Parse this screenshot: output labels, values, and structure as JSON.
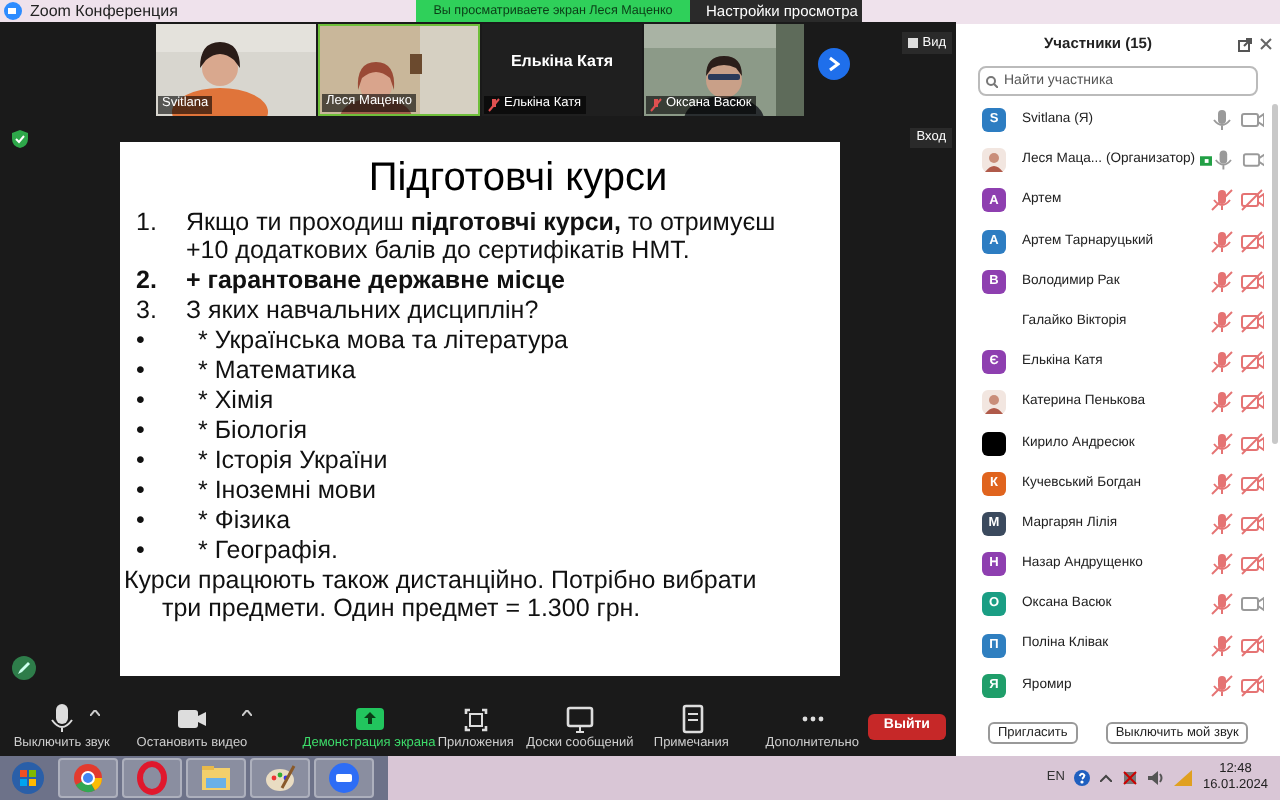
{
  "window": {
    "title": "Zoom Конференция"
  },
  "share_banner": {
    "text": "Вы просматриваете экран Леся Маценко",
    "view_settings": "Настройки просмотра"
  },
  "video_tiles": [
    {
      "name": "Svitlana",
      "kind": "picture",
      "muted": false
    },
    {
      "name": "Леся Маценко",
      "kind": "picture",
      "muted": false
    },
    {
      "name": "Елькіна Катя",
      "kind": "no_video",
      "muted": true,
      "center_name": "Елькіна Катя"
    },
    {
      "name": "Оксана Васюк",
      "kind": "picture",
      "muted": true
    }
  ],
  "view_button": "Вид",
  "enter_label": "Вход",
  "slide": {
    "title": "Підготовчі курси",
    "lines": [
      {
        "kind": "numbered",
        "marker": "1.",
        "text": "Якщо ти проходиш **підготовчі курси,** то отримуєш +10 додаткових балів до  сертифікатів НМТ.",
        "bold": false
      },
      {
        "kind": "numbered",
        "marker": "2.",
        "text": "+ гарантоване державне місце",
        "bold": true
      },
      {
        "kind": "numbered",
        "marker": "3.",
        "text": "З яких навчальних дисциплін?",
        "bold": false
      },
      {
        "kind": "bullet",
        "marker": "•",
        "text": "* Українська мова та література",
        "bold": false
      },
      {
        "kind": "bullet",
        "marker": "•",
        "text": "* Математика",
        "bold": false
      },
      {
        "kind": "bullet",
        "marker": "•",
        "text": "* Хімія",
        "bold": false
      },
      {
        "kind": "bullet",
        "marker": "•",
        "text": "* Біологія",
        "bold": false
      },
      {
        "kind": "bullet",
        "marker": "•",
        "text": "* Історія України",
        "bold": false
      },
      {
        "kind": "bullet",
        "marker": "•",
        "text": "* Іноземні мови",
        "bold": false
      },
      {
        "kind": "bullet",
        "marker": "•",
        "text": "* Фізика",
        "bold": false
      },
      {
        "kind": "bullet",
        "marker": "•",
        "text": "* Географія.",
        "bold": false
      },
      {
        "kind": "plain",
        "text": "Курси працюють також дистанційно. Потрібно вибрати три предмети. Один предмет = 1.300 грн.",
        "bold": false
      }
    ]
  },
  "toolbar": [
    {
      "kind": "mic",
      "label": "Выключить звук",
      "caret": true,
      "active": false
    },
    {
      "kind": "video",
      "label": "Остановить видео",
      "caret": true,
      "active": false
    },
    {
      "kind": "share",
      "label": "Демонстрация экрана",
      "caret": false,
      "active": true
    },
    {
      "kind": "apps",
      "label": "Приложения",
      "caret": false,
      "active": false
    },
    {
      "kind": "board",
      "label": "Доски сообщений",
      "caret": false,
      "active": false
    },
    {
      "kind": "notes",
      "label": "Примечания",
      "caret": false,
      "active": false
    },
    {
      "kind": "more",
      "label": "Дополнительно",
      "caret": false,
      "active": false
    }
  ],
  "leave_button": "Выйти",
  "participants": {
    "title": "Участники (15)",
    "search_placeholder": "Найти участника",
    "items": [
      {
        "name": "Svitlana (Я)",
        "kind": "letter",
        "letter": "S",
        "color": "#2d7dc2",
        "mic_muted": false,
        "video_off": false
      },
      {
        "name": "Леся Маца... (Организатор)",
        "mic_muted": false,
        "video_off": false,
        "sharing": true
      },
      {
        "name": "Артем",
        "kind": "letter",
        "letter": "А",
        "color": "#8e3fb0",
        "mic_muted": true,
        "video_off": true
      },
      {
        "name": "Артем Тарнаруцький",
        "kind": "letter",
        "letter": "А",
        "color": "#2d7dc2",
        "mic_muted": true,
        "video_off": true
      },
      {
        "name": "Володимир Рак",
        "kind": "letter",
        "letter": "В",
        "color": "#8e3fb0",
        "mic_muted": true,
        "video_off": true
      },
      {
        "name": "Галайко Вікторія",
        "kind": "none",
        "mic_muted": true,
        "video_off": true
      },
      {
        "name": "Елькіна Катя",
        "kind": "letter",
        "letter": "Є",
        "color": "#8e3fb0",
        "mic_muted": true,
        "video_off": true
      },
      {
        "name": "Катерина Пенькова",
        "mic_muted": true,
        "video_off": true
      },
      {
        "name": "Кирило Андресюк",
        "kind": "letter",
        "color": "#000000",
        "mic_muted": true,
        "video_off": true
      },
      {
        "name": "Кучевський Богдан",
        "kind": "letter",
        "letter": "К",
        "color": "#e0641e",
        "mic_muted": true,
        "video_off": true
      },
      {
        "name": "Маргарян Лілія",
        "kind": "letter",
        "letter": "М",
        "color": "#3b4a5e",
        "mic_muted": true,
        "video_off": true
      },
      {
        "name": "Назар Андрущенко",
        "kind": "letter",
        "letter": "Н",
        "color": "#8e3fb0",
        "mic_muted": true,
        "video_off": true
      },
      {
        "name": "Оксана Васюк",
        "kind": "letter",
        "letter": "О",
        "color": "#1a9e84",
        "mic_muted": true,
        "video_off": false
      },
      {
        "name": "Поліна Клівак",
        "kind": "letter",
        "letter": "П",
        "color": "#2f7fc0",
        "mic_muted": true,
        "video_off": true
      },
      {
        "name": "Яромир",
        "kind": "letter",
        "letter": "Я",
        "color": "#1f9e6a",
        "mic_muted": true,
        "video_off": true
      }
    ],
    "invite_button": "Пригласить",
    "mute_me_button": "Выключить мой звук"
  },
  "taskbar": {
    "apps": [
      {
        "kind": "start"
      },
      {
        "kind": "chrome"
      },
      {
        "kind": "opera"
      },
      {
        "kind": "explorer"
      },
      {
        "kind": "paint"
      },
      {
        "kind": "zoom"
      }
    ],
    "language": "EN",
    "time": "12:48",
    "date": "16.01.2024"
  }
}
